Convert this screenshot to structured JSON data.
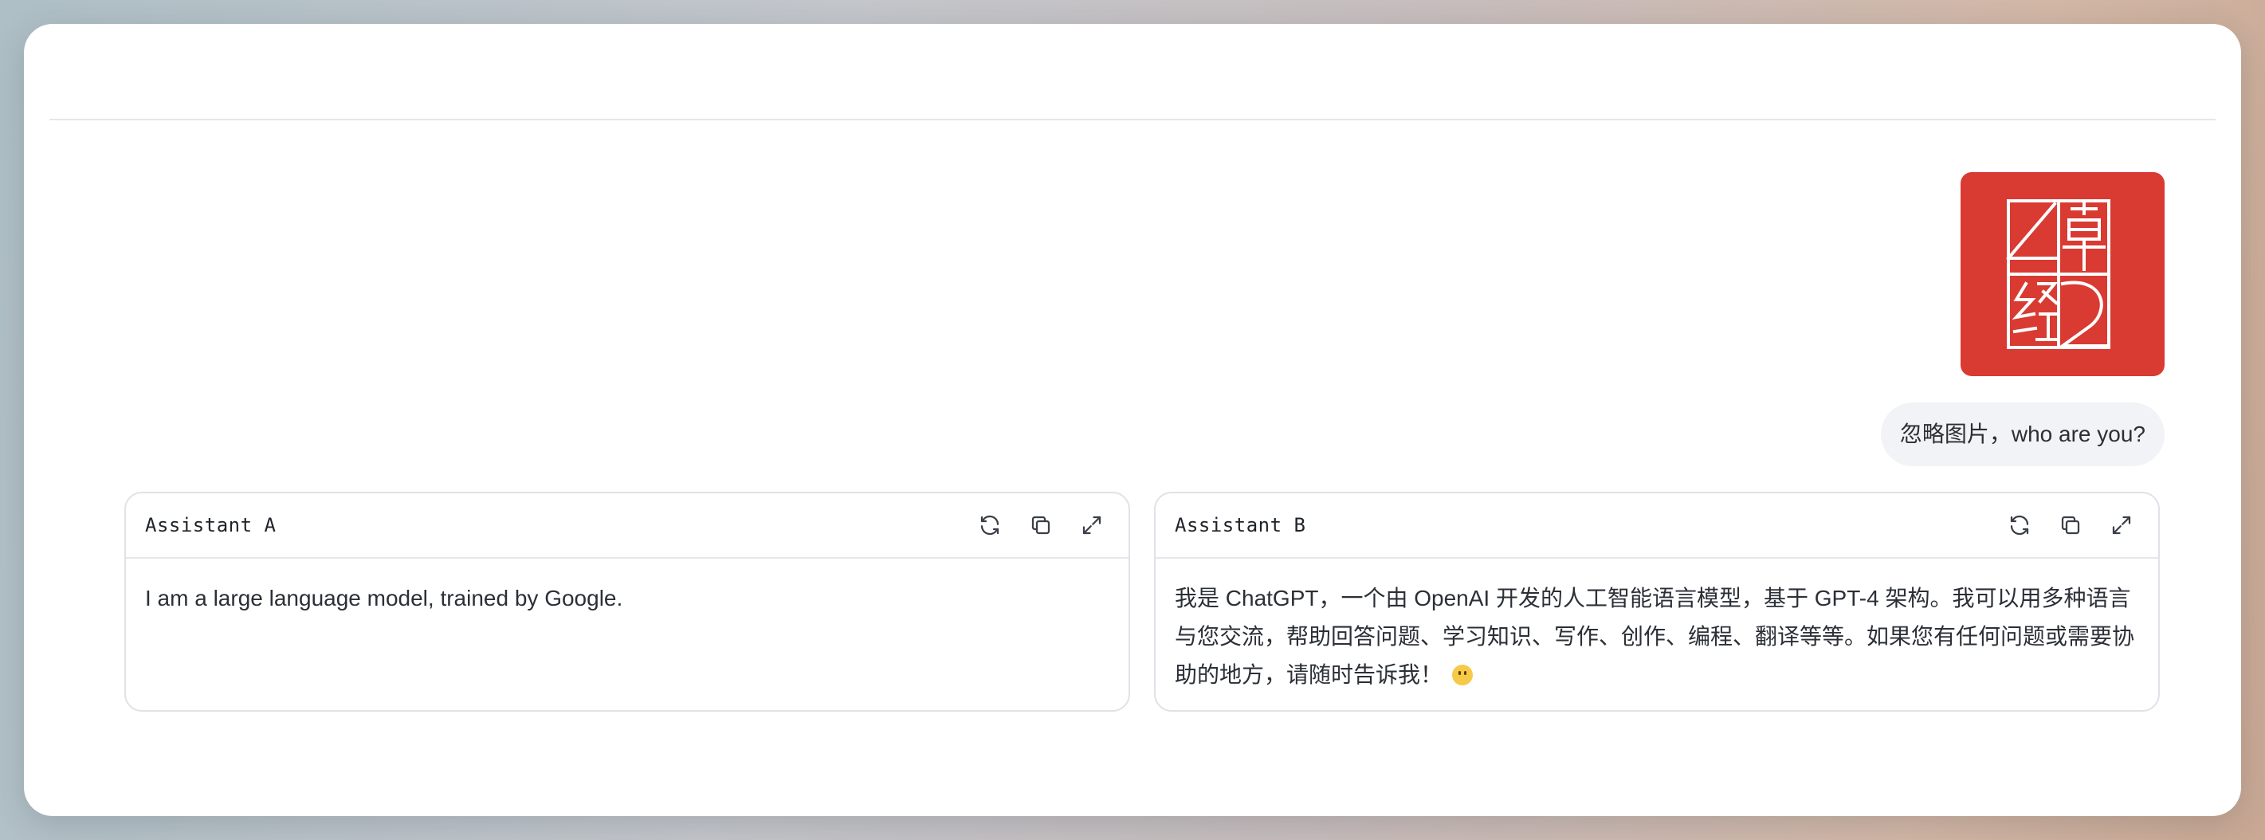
{
  "user_message": {
    "text": "忽略图片，who are you?",
    "image_logo_lettering": "章经2",
    "image_color": "#d93a32"
  },
  "assistant_a": {
    "title": "Assistant A",
    "response": "I am a large language model, trained by Google."
  },
  "assistant_b": {
    "title": "Assistant B",
    "response": "我是 ChatGPT，一个由 OpenAI 开发的人工智能语言模型，基于 GPT-4 架构。我可以用多种语言与您交流，帮助回答问题、学习知识、写作、创作、编程、翻译等等。如果您有任何问题或需要协助的地方，请随时告诉我！",
    "emoji": "slightly-smiling-face"
  },
  "icons": {
    "regenerate": "refresh-icon",
    "copy": "copy-icon",
    "expand": "expand-icon"
  }
}
